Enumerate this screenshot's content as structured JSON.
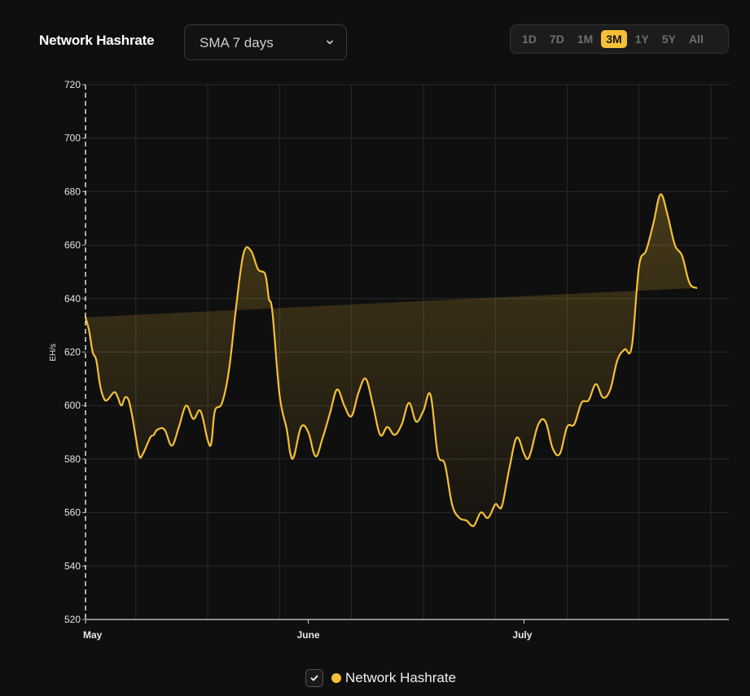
{
  "header": {
    "title": "Network Hashrate",
    "dropdown_value": "SMA 7 days",
    "ranges": [
      "1D",
      "7D",
      "1M",
      "3M",
      "1Y",
      "5Y",
      "All"
    ],
    "active_range": "3M"
  },
  "legend": {
    "label": "Network Hashrate"
  },
  "colors": {
    "accent": "#f5c037",
    "background": "#0f0f0f",
    "grid": "#2a2a2a"
  },
  "chart_data": {
    "type": "area",
    "title": "",
    "ylabel": "EH/s",
    "xlabel": "",
    "ylim": [
      520,
      720
    ],
    "y_ticks": [
      520,
      540,
      560,
      580,
      600,
      620,
      640,
      660,
      680,
      700,
      720
    ],
    "x_ticks": [
      {
        "label": "May",
        "day": 0
      },
      {
        "label": "June",
        "day": 31
      },
      {
        "label": "July",
        "day": 61
      }
    ],
    "grid": true,
    "legend_position": "bottom",
    "series": [
      {
        "name": "Network Hashrate",
        "x_days": [
          0,
          0.5,
          1,
          1.5,
          2,
          2.5,
          3,
          4,
          4.5,
          5,
          5.5,
          6,
          6.5,
          7,
          7.5,
          8,
          9,
          9.5,
          10,
          11,
          12,
          13,
          14,
          15,
          16,
          17,
          17.5,
          18,
          19,
          20,
          21,
          22,
          23,
          24,
          25,
          25.5,
          26,
          27,
          28,
          28.5,
          29,
          30,
          31,
          32,
          33,
          34,
          35,
          36,
          37,
          38,
          39,
          40,
          41,
          42,
          43,
          44,
          45,
          46,
          47,
          48,
          49,
          50,
          51,
          52,
          53,
          54,
          55,
          56,
          57,
          57.5,
          58,
          59,
          60,
          61,
          61.5,
          62,
          63,
          64,
          65,
          66,
          67,
          68,
          69,
          70,
          71,
          72,
          73,
          74,
          75,
          76,
          77,
          78,
          79,
          80,
          81,
          82,
          83,
          84,
          85,
          86,
          87,
          88,
          89,
          89.5
        ],
        "values": [
          633,
          628,
          620,
          617,
          608,
          603,
          602,
          605,
          603,
          600,
          603,
          602,
          596,
          588,
          581,
          582,
          588,
          589,
          591,
          591,
          585,
          592,
          600,
          595,
          598,
          587,
          586,
          598,
          601,
          614,
          638,
          657,
          658,
          651,
          649,
          640,
          635,
          604,
          591,
          582,
          581,
          592,
          590,
          581,
          588,
          597,
          606,
          600,
          596,
          605,
          610,
          600,
          589,
          592,
          589,
          593,
          601,
          594,
          598,
          604,
          582,
          578,
          563,
          558,
          557,
          555,
          560,
          558,
          563,
          562,
          563,
          577,
          588,
          582,
          580,
          583,
          593,
          594,
          584,
          582,
          592,
          593,
          601,
          602,
          608,
          603,
          606,
          617,
          621,
          622,
          652,
          658,
          668,
          679,
          671,
          660,
          656,
          646,
          644,
          644
        ]
      }
    ]
  }
}
